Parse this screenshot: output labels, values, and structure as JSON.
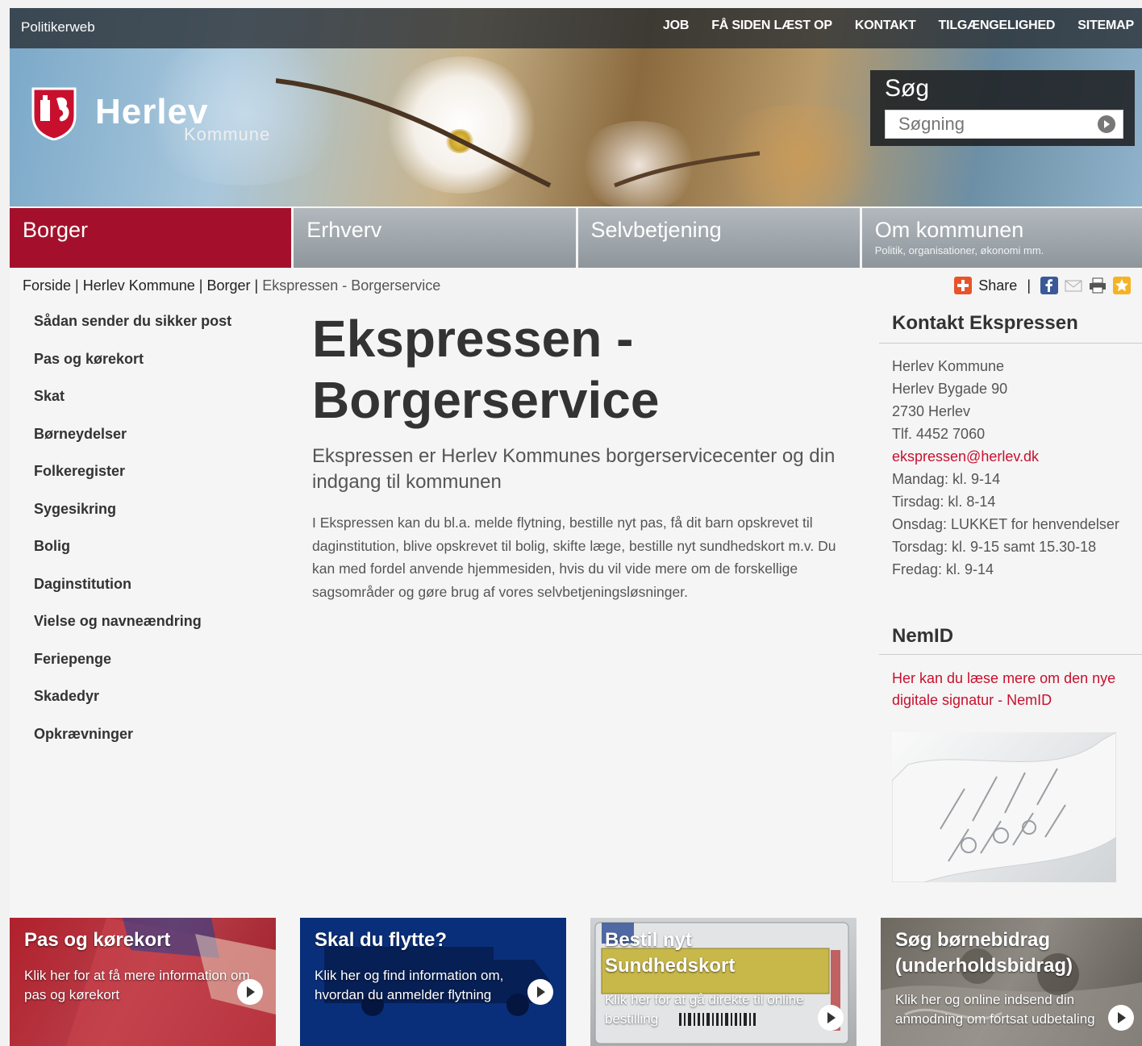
{
  "topbar": {
    "site_name": "Politikerweb",
    "links": [
      "JOB",
      "FÅ SIDEN LÆST OP",
      "KONTAKT",
      "TILGÆNGELIGHED",
      "SITEMAP"
    ]
  },
  "logo": {
    "name": "Herlev",
    "sub": "Kommune"
  },
  "search": {
    "label": "Søg",
    "placeholder": "Søgning"
  },
  "mainnav": [
    {
      "label": "Borger",
      "sub": "",
      "active": true
    },
    {
      "label": "Erhverv",
      "sub": "",
      "active": false
    },
    {
      "label": "Selvbetjening",
      "sub": "",
      "active": false
    },
    {
      "label": "Om kommunen",
      "sub": "Politik, organisationer, økonomi mm.",
      "active": false
    }
  ],
  "breadcrumb": {
    "items": [
      "Forside",
      "Herlev Kommune",
      "Borger"
    ],
    "current": "Ekspressen - Borgerservice",
    "sep": " | "
  },
  "share": {
    "label": "Share",
    "sep": "|"
  },
  "sidenav": [
    "Sådan sender du sikker post",
    "Pas og kørekort",
    "Skat",
    "Børneydelser",
    "Folkeregister",
    "Sygesikring",
    "Bolig",
    "Daginstitution",
    "Vielse og navneændring",
    "Feriepenge",
    "Skadedyr",
    "Opkrævninger"
  ],
  "content": {
    "title_line1": "Ekspressen -",
    "title_line2": "Borgerservice",
    "lead": "Ekspressen er Herlev Kommunes borgerservicecenter og din indgang til kommunen",
    "body": "I Ekspressen kan du bl.a. melde flytning, bestille nyt pas, få dit barn opskrevet til daginstitution, blive opskrevet til bolig, skifte læge, bestille nyt sundhedskort m.v. Du kan med fordel anvende hjemmesiden, hvis du vil vide mere om de forskellige sagsområder og gøre brug af vores selvbetjeningsløsninger."
  },
  "contact": {
    "heading": "Kontakt Ekspressen",
    "lines": [
      "Herlev Kommune",
      "Herlev Bygade 90",
      "2730 Herlev",
      "Tlf. 4452 7060"
    ],
    "email": "ekspressen@herlev.dk",
    "hours": [
      "Mandag: kl. 9-14",
      "Tirsdag: kl. 8-14",
      "Onsdag: LUKKET for henvendelser",
      "Torsdag: kl. 9-15 samt 15.30-18",
      "Fredag: kl. 9-14"
    ]
  },
  "nemid": {
    "heading": "NemID",
    "link": "Her kan du læse mere om den nye digitale signatur - NemID"
  },
  "promos": [
    {
      "title": "Pas og kørekort",
      "desc": "Klik her for at få mere information om pas og kørekort"
    },
    {
      "title": "Skal du flytte?",
      "desc": "Klik her og find information om, hvordan du anmelder flytning"
    },
    {
      "title": "Bestil nyt Sundhedskort",
      "desc": "Klik her for at gå direkte til online bestilling"
    },
    {
      "title": "Søg børnebidrag (underholdsbidrag)",
      "desc": "Klik her og online indsend din anmodning om fortsat udbetaling"
    }
  ],
  "colors": {
    "accent": "#a4102b",
    "link": "#c8102e",
    "promo_blue": "#0a2f7a"
  }
}
